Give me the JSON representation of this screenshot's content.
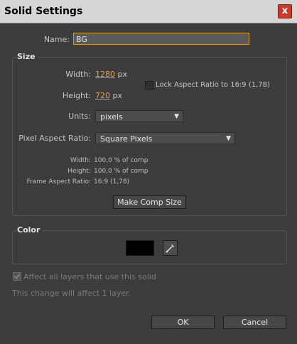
{
  "window": {
    "title": "Solid Settings",
    "close_glyph": "x"
  },
  "name": {
    "label": "Name:",
    "value": "BG"
  },
  "size": {
    "group_title": "Size",
    "width_label": "Width:",
    "width_value": "1280",
    "width_unit": "px",
    "height_label": "Height:",
    "height_value": "720",
    "height_unit": "px",
    "lock_label": "Lock Aspect Ratio to 16:9 (1,78)",
    "units_label": "Units:",
    "units_value": "pixels",
    "par_label": "Pixel Aspect Ratio:",
    "par_value": "Square Pixels",
    "info": {
      "width_label": "Width:",
      "width_value": "100,0 % of comp",
      "height_label": "Height:",
      "height_value": "100,0 % of comp",
      "far_label": "Frame Aspect Ratio:",
      "far_value": "16:9 (1,78)"
    },
    "make_comp_button": "Make Comp Size"
  },
  "color": {
    "group_title": "Color",
    "swatch_hex": "#000000"
  },
  "affect_label": "Affect all layers that use this solid",
  "change_note": "This change will affect 1 layer.",
  "buttons": {
    "ok": "OK",
    "cancel": "Cancel"
  }
}
